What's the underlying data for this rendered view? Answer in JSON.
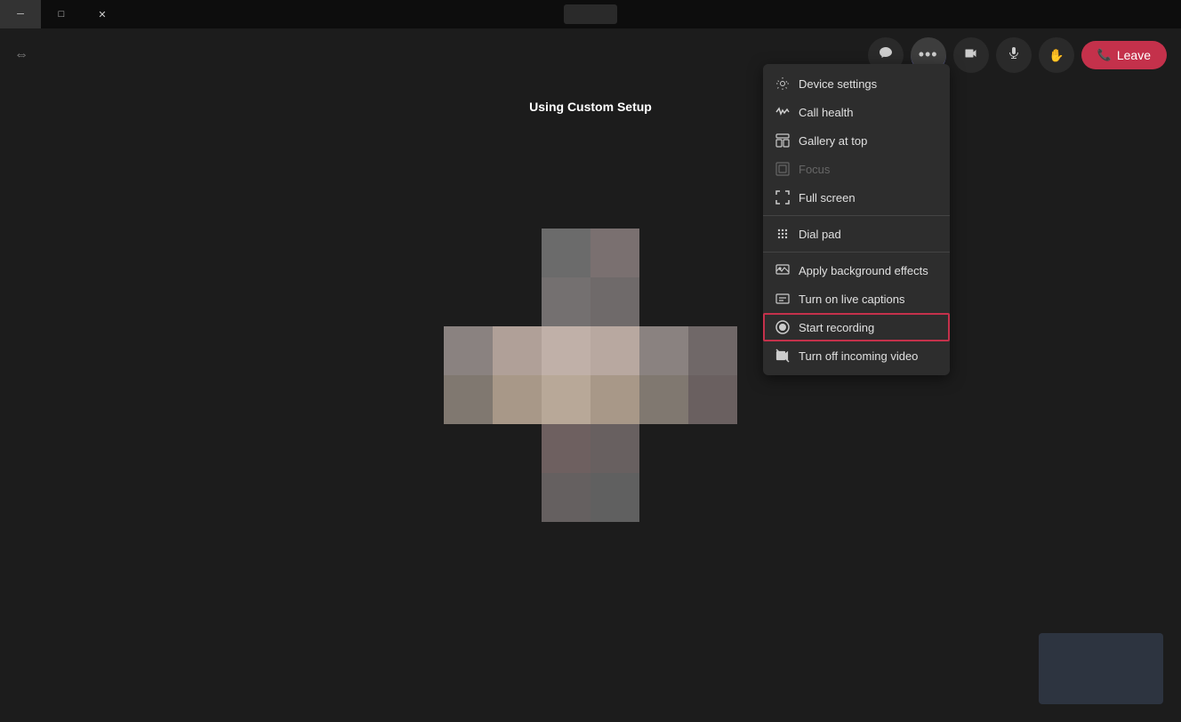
{
  "titlebar": {
    "minimize_label": "─",
    "maximize_label": "□",
    "close_label": "✕"
  },
  "call": {
    "label": "Using Custom Setup",
    "leave_label": "Leave",
    "leave_icon": "📞"
  },
  "controls": {
    "chat_icon": "💬",
    "more_icon": "•••",
    "video_icon": "📷",
    "mic_icon": "🎤",
    "hand_icon": "✋"
  },
  "menu": {
    "items": [
      {
        "id": "device-settings",
        "label": "Device settings",
        "icon": "⚙",
        "disabled": false,
        "highlighted": false,
        "divider_after": false
      },
      {
        "id": "call-health",
        "label": "Call health",
        "icon": "〜",
        "disabled": false,
        "highlighted": false,
        "divider_after": false
      },
      {
        "id": "gallery-at-top",
        "label": "Gallery at top",
        "icon": "▣",
        "disabled": false,
        "highlighted": false,
        "divider_after": false
      },
      {
        "id": "focus",
        "label": "Focus",
        "icon": "▣",
        "disabled": true,
        "highlighted": false,
        "divider_after": false
      },
      {
        "id": "full-screen",
        "label": "Full screen",
        "icon": "⛶",
        "disabled": false,
        "highlighted": false,
        "divider_after": true
      },
      {
        "id": "dial-pad",
        "label": "Dial pad",
        "icon": "⠿",
        "disabled": false,
        "highlighted": false,
        "divider_after": true
      },
      {
        "id": "apply-background",
        "label": "Apply background effects",
        "icon": "🖼",
        "disabled": false,
        "highlighted": false,
        "divider_after": false
      },
      {
        "id": "live-captions",
        "label": "Turn on live captions",
        "icon": "⊡",
        "disabled": false,
        "highlighted": false,
        "divider_after": false
      },
      {
        "id": "start-recording",
        "label": "Start recording",
        "icon": "⊙",
        "disabled": false,
        "highlighted": true,
        "divider_after": false
      },
      {
        "id": "turn-off-video",
        "label": "Turn off incoming video",
        "icon": "🎥",
        "disabled": false,
        "highlighted": false,
        "divider_after": false
      }
    ]
  },
  "pixels": {
    "colors": [
      "#6b6b6b",
      "#7a7a7a",
      "#5a5a5a",
      "#9a8a80",
      "#b8a090",
      "#8a8080",
      "#8a7870",
      "#706868",
      "#6a6060"
    ]
  },
  "thumbnail": {
    "bg": "#2d3440"
  }
}
